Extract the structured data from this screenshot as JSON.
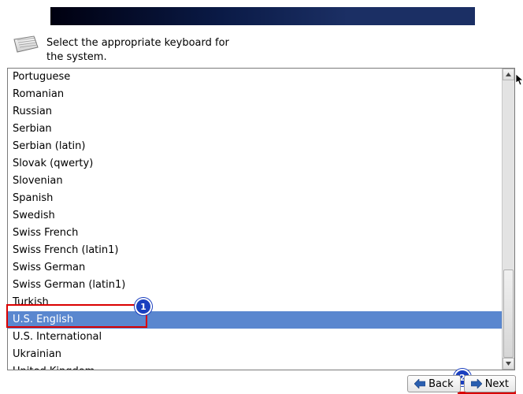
{
  "instruction_line1": "Select the appropriate keyboard for",
  "instruction_line2": "the system.",
  "keyboard_items": [
    "Portuguese",
    "Romanian",
    "Russian",
    "Serbian",
    "Serbian (latin)",
    "Slovak (qwerty)",
    "Slovenian",
    "Spanish",
    "Swedish",
    "Swiss French",
    "Swiss French (latin1)",
    "Swiss German",
    "Swiss German (latin1)",
    "Turkish",
    "U.S. English",
    "U.S. International",
    "Ukrainian",
    "United Kingdom"
  ],
  "selected_index": 14,
  "buttons": {
    "back": "Back",
    "next": "Next"
  },
  "annotations": {
    "badge1": "1",
    "badge2": "2"
  }
}
